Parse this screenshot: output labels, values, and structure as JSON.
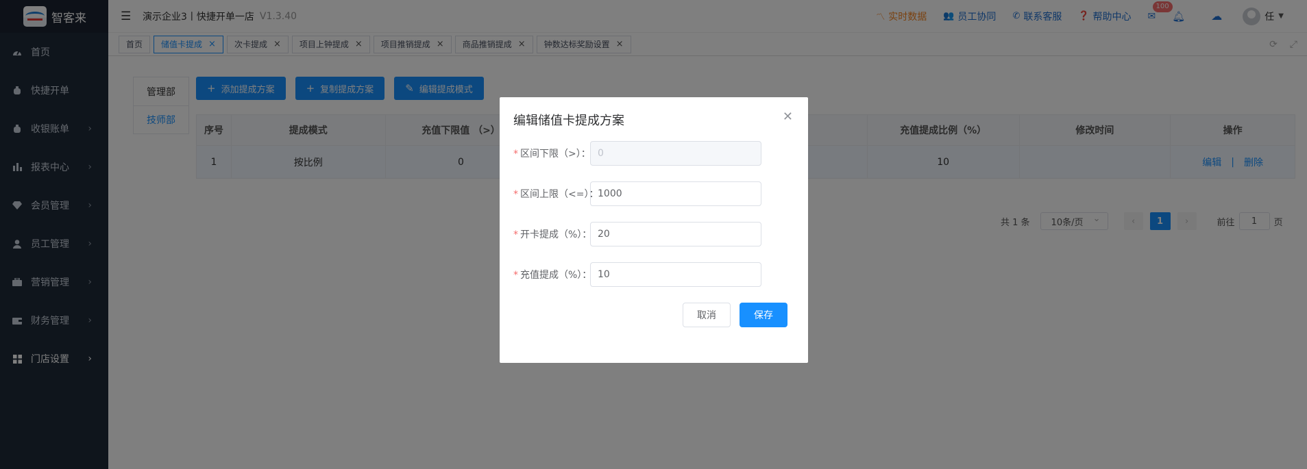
{
  "app": {
    "brand": "智客来",
    "logo_text": "智客来"
  },
  "header": {
    "store_title": "演示企业3丨快捷开单一店",
    "version": "V1.3.40",
    "links": [
      {
        "label": "实时数据",
        "icon": "chart-line-icon"
      },
      {
        "label": "员工协同",
        "icon": "users-icon"
      },
      {
        "label": "联系客服",
        "icon": "phone-icon"
      },
      {
        "label": "帮助中心",
        "icon": "question-icon"
      }
    ],
    "mail_badge": "100",
    "user": "任"
  },
  "sidebar": {
    "items": [
      {
        "label": "首页"
      },
      {
        "label": "快捷开单"
      },
      {
        "label": "收银账单"
      },
      {
        "label": "报表中心"
      },
      {
        "label": "会员管理"
      },
      {
        "label": "员工管理"
      },
      {
        "label": "营销管理"
      },
      {
        "label": "财务管理"
      },
      {
        "label": "门店设置"
      }
    ]
  },
  "tabs": [
    {
      "label": "首页"
    },
    {
      "label": "储值卡提成"
    },
    {
      "label": "次卡提成"
    },
    {
      "label": "项目上钟提成"
    },
    {
      "label": "项目推销提成"
    },
    {
      "label": "商品推销提成"
    },
    {
      "label": "钟数达标奖励设置"
    }
  ],
  "departments": [
    {
      "label": "管理部"
    },
    {
      "label": "技师部"
    }
  ],
  "actions": {
    "add": "添加提成方案",
    "copy": "复制提成方案",
    "edit": "编辑提成模式"
  },
  "table": {
    "headers": [
      "序号",
      "提成模式",
      "充值下限值 （>）",
      "",
      "",
      "充值提成比例（%）",
      "修改时间",
      "操作"
    ],
    "rows": [
      {
        "index": "1",
        "mode": "按比例",
        "min": "0",
        "rate": "10",
        "time": "",
        "edit": "编辑",
        "sep": "|",
        "delete": "删除"
      }
    ]
  },
  "pagination": {
    "total": "共 1 条",
    "page_size": "10条/页",
    "current": "1",
    "goto": "前往",
    "goto_value": "1",
    "page_suffix": "页"
  },
  "dialog": {
    "title": "编辑储值卡提成方案",
    "fields": [
      {
        "label": "区间下限（>）：",
        "value": "0"
      },
      {
        "label": "区间上限（<=）：",
        "value": "1000"
      },
      {
        "label": "开卡提成（%）：",
        "value": "20"
      },
      {
        "label": "充值提成（%）：",
        "value": "10"
      }
    ],
    "cancel": "取消",
    "save": "保存"
  },
  "colors": {
    "primary": "#1890ff",
    "sidebar": "#1f2a38",
    "accent_orange": "#f5821f",
    "badge": "#f56c6c"
  }
}
